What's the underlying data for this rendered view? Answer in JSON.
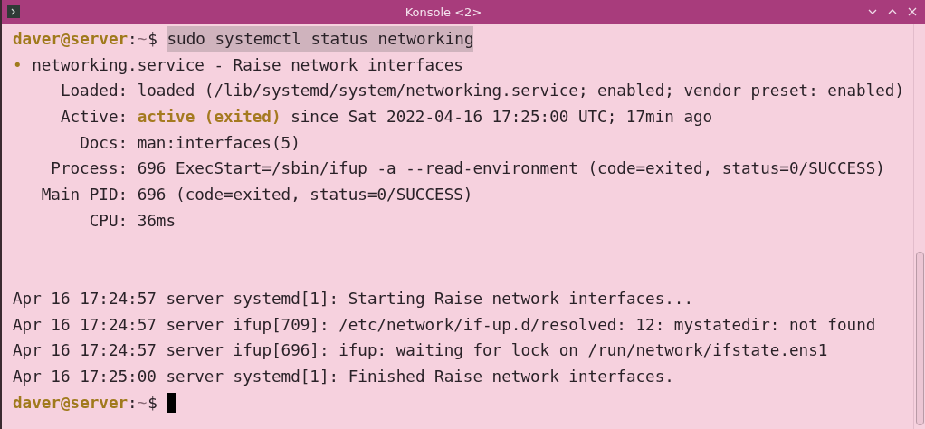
{
  "window": {
    "title": "Konsole <2>",
    "controls": [
      {
        "kind": "minimize"
      },
      {
        "kind": "maximize"
      },
      {
        "kind": "close"
      }
    ]
  },
  "terminal": {
    "lines": [
      {
        "kind": "prompt",
        "user_host": "daver@server",
        "separator": ":",
        "path": "~",
        "symbol": "$",
        "command": "sudo systemctl status networking",
        "command_selected": true
      },
      {
        "kind": "unit",
        "bullet": "•",
        "text": "networking.service - Raise network interfaces"
      },
      {
        "kind": "field",
        "label": "Loaded:",
        "value": "loaded (/lib/systemd/system/networking.service; enabled; vendor preset: enabled)"
      },
      {
        "kind": "field",
        "label": "Active:",
        "highlight": "active (exited)",
        "value": "since Sat 2022-04-16 17:25:00 UTC; 17min ago"
      },
      {
        "kind": "field",
        "label": "Docs:",
        "value": "man:interfaces(5)"
      },
      {
        "kind": "field",
        "label": "Process:",
        "value": "696 ExecStart=/sbin/ifup -a --read-environment (code=exited, status=0/SUCCESS)"
      },
      {
        "kind": "field",
        "label": "Main PID:",
        "value": "696 (code=exited, status=0/SUCCESS)"
      },
      {
        "kind": "field",
        "label": "CPU:",
        "value": "36ms"
      },
      {
        "kind": "blank"
      },
      {
        "kind": "blank"
      },
      {
        "kind": "log",
        "text": "Apr 16 17:24:57 server systemd[1]: Starting Raise network interfaces..."
      },
      {
        "kind": "log",
        "text": "Apr 16 17:24:57 server ifup[709]: /etc/network/if-up.d/resolved: 12: mystatedir: not found"
      },
      {
        "kind": "log",
        "text": "Apr 16 17:24:57 server ifup[696]: ifup: waiting for lock on /run/network/ifstate.ens1"
      },
      {
        "kind": "log",
        "text": "Apr 16 17:25:00 server systemd[1]: Finished Raise network interfaces."
      },
      {
        "kind": "prompt",
        "user_host": "daver@server",
        "separator": ":",
        "path": "~",
        "symbol": "$",
        "cursor": true
      }
    ]
  }
}
